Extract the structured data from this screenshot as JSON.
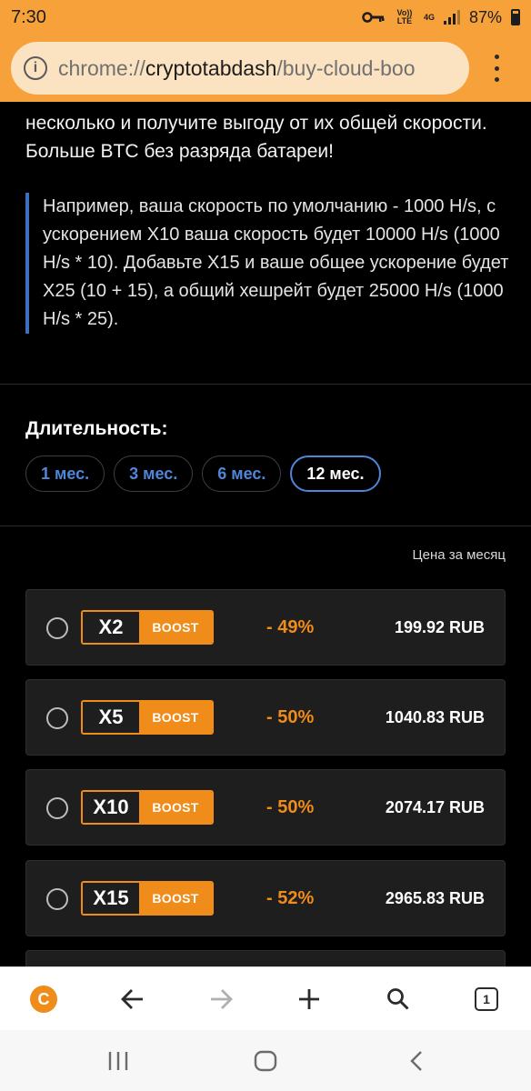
{
  "status_bar": {
    "time": "7:30",
    "volte": "Vo)) LTE",
    "network": "4G",
    "battery": "87%"
  },
  "browser": {
    "url_scheme": "chrome://",
    "url_host": "cryptotabdash",
    "url_path": "/buy-cloud-boo"
  },
  "content": {
    "intro": "несколько и получите выгоду от их общей скорости. Больше BTC без разряда батареи!",
    "example": "Например, ваша скорость по умолчанию - 1000 H/s, с ускорением X10 ваша скорость будет 10000 H/s (1000 H/s * 10). Добавьте X15 и ваше общее ускорение будет X25 (10 + 15), а общий хешрейт будет 25000 H/s (1000 H/s * 25).",
    "duration_title": "Длительность:",
    "duration_options": [
      "1 мес.",
      "3 мес.",
      "6 мес.",
      "12 мес."
    ],
    "duration_selected": "12 мес.",
    "price_header": "Цена за месяц",
    "boost_label": "BOOST",
    "boosts": [
      {
        "multiplier": "X2",
        "discount": "- 49%",
        "price": "199.92 RUB"
      },
      {
        "multiplier": "X5",
        "discount": "- 50%",
        "price": "1040.83 RUB"
      },
      {
        "multiplier": "X10",
        "discount": "- 50%",
        "price": "2074.17 RUB"
      },
      {
        "multiplier": "X15",
        "discount": "- 52%",
        "price": "2965.83 RUB"
      }
    ]
  },
  "toolbar": {
    "tab_count": "1",
    "logo_letter": "C"
  },
  "colors": {
    "accent_orange": "#f08c1a",
    "link_blue": "#4f86d9",
    "topbar": "#f7a13a"
  }
}
